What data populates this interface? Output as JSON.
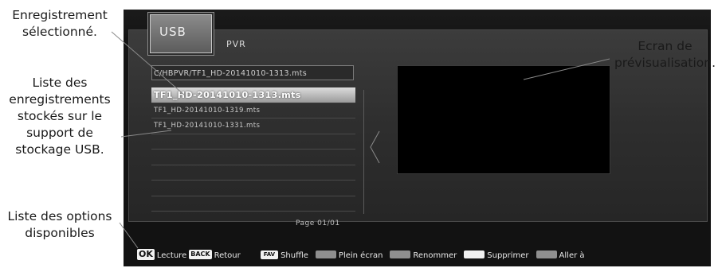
{
  "annotations": {
    "selected": [
      "Enregistrement",
      "sélectionné."
    ],
    "list": [
      "Liste des",
      "enregistrements",
      "stockés sur le",
      "support de",
      "stockage USB."
    ],
    "options": [
      "Liste des options",
      "disponibles"
    ],
    "preview": [
      "Ecran de",
      "prévisualisation."
    ]
  },
  "header": {
    "source_label": "USB",
    "title": "PVR"
  },
  "path": "C/HBPVR/TF1_HD-20141010-1313.mts",
  "recordings": [
    "TF1_HD-20141010-1313.mts",
    "TF1_HD-20141010-1319.mts",
    "TF1_HD-20141010-1331.mts",
    "",
    "",
    "",
    "",
    "",
    ""
  ],
  "selected_index": 0,
  "page_indicator": "Page 01/01",
  "options_bar": {
    "ok_key": "OK",
    "ok_label": "Lecture",
    "back_key": "BACK",
    "back_label": "Retour",
    "fav_key": "FAV",
    "fav_label": "Shuffle",
    "red_label": "Plein écran",
    "green_label": "Renommer",
    "yellow_label": "Supprimer",
    "blue_label": "Aller à"
  }
}
